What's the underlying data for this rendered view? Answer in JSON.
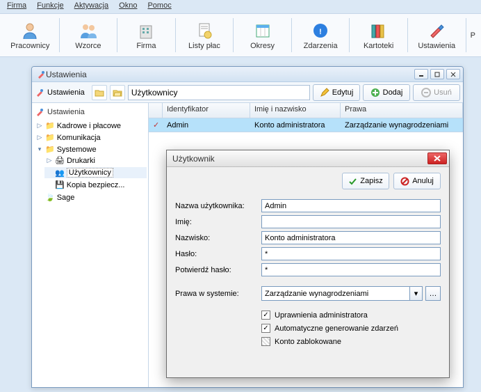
{
  "menu": [
    "Firma",
    "Funkcje",
    "Aktywacja",
    "Okno",
    "Pomoc"
  ],
  "ribbon": [
    {
      "label": "Pracownicy"
    },
    {
      "label": "Wzorce"
    },
    {
      "label": "Firma"
    },
    {
      "label": "Listy płac"
    },
    {
      "label": "Okresy"
    },
    {
      "label": "Zdarzenia"
    },
    {
      "label": "Kartoteki"
    },
    {
      "label": "Ustawienia"
    },
    {
      "label": "P"
    }
  ],
  "child_title": "Ustawienia",
  "toolbar": {
    "title": "Ustawienia",
    "path_value": "Użytkownicy",
    "edit": "Edytuj",
    "add": "Dodaj",
    "remove": "Usuń"
  },
  "tree": {
    "root": "Ustawienia",
    "kadrowe": "Kadrowe i płacowe",
    "komunikacja": "Komunikacja",
    "systemowe": "Systemowe",
    "drukarki": "Drukarki",
    "uzytkownicy": "Użytkownicy",
    "kopia": "Kopia bezpiecz...",
    "sage": "Sage"
  },
  "grid": {
    "cols": [
      "",
      "Identyfikator",
      "Imię i nazwisko",
      "Prawa"
    ],
    "row": {
      "id": "Admin",
      "name": "Konto administratora",
      "rights": "Zarządzanie wynagrodzeniami"
    }
  },
  "modal": {
    "title": "Użytkownik",
    "save": "Zapisz",
    "cancel": "Anuluj",
    "labels": {
      "username": "Nazwa użytkownika:",
      "first": "Imię:",
      "last": "Nazwisko:",
      "pass": "Hasło:",
      "confirm": "Potwierdź hasło:",
      "rights": "Prawa w systemie:"
    },
    "values": {
      "username": "Admin",
      "first": "",
      "last": "Konto administratora",
      "pass": "*",
      "confirm": "*",
      "rights": "Zarządzanie wynagrodzeniami"
    },
    "checks": {
      "admin": "Uprawnienia administratora",
      "auto": "Automatyczne generowanie zdarzeń",
      "locked": "Konto zablokowane"
    },
    "checkvals": {
      "admin": true,
      "auto": true,
      "locked": false
    }
  }
}
